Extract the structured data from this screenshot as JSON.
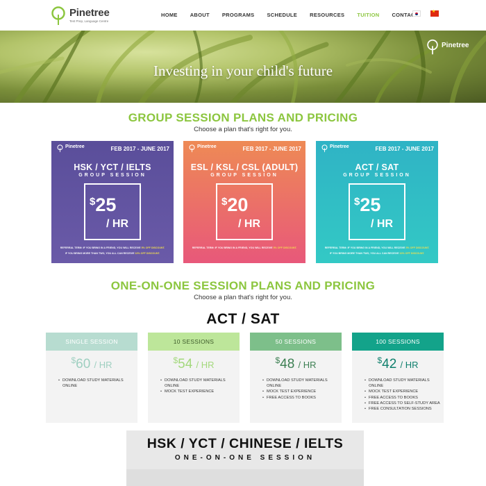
{
  "brand": {
    "name": "Pinetree",
    "tagline": "Test Prep, Language Centre",
    "accent_color": "#8cc63f"
  },
  "nav": {
    "items": [
      {
        "label": "HOME"
      },
      {
        "label": "ABOUT"
      },
      {
        "label": "PROGRAMS"
      },
      {
        "label": "SCHEDULE"
      },
      {
        "label": "RESOURCES"
      },
      {
        "label": "TUITION",
        "active": true
      },
      {
        "label": "CONTACT"
      }
    ],
    "flags": [
      "korea-flag-icon",
      "china-flag-icon"
    ]
  },
  "hero": {
    "title": "Investing in your child's future",
    "logo": "Pinetree"
  },
  "group": {
    "title": "GROUP SESSION PLANS AND PRICING",
    "subtitle": "Choose a plan that's right for you.",
    "cards": [
      {
        "logo": "Pinetree",
        "date": "FEB 2017 - JUNE 2017",
        "name": "HSK / YCT / IELTS",
        "kind": "GROUP SESSION",
        "currency": "$",
        "price": "25",
        "unit": "/ HR",
        "referral_1": "REFERRAL TERM: IF YOU BRING IN A FRIEND, YOU WILL RECEIVE 5% OFF DISCOUNT.",
        "referral_2": "IF YOU BRING MORE THAN TWO, YOU ALL CAN RECEIVE 10% OFF DISCOUNT."
      },
      {
        "logo": "Pinetree",
        "date": "FEB 2017 - JUNE 2017",
        "name": "ESL / KSL / CSL (ADULT)",
        "kind": "GROUP SESSION",
        "currency": "$",
        "price": "20",
        "unit": "/ HR",
        "referral_1": "REFERRAL TERM: IF YOU BRING IN A FRIEND, YOU WILL RECEIVE 5% OFF DISCOUNT."
      },
      {
        "logo": "Pinetree",
        "date": "FEB 2017 - JUNE 2017",
        "name": "ACT / SAT",
        "kind": "GROUP SESSION",
        "currency": "$",
        "price": "25",
        "unit": "/ HR",
        "referral_1": "REFERRAL TERM: IF YOU BRING IN A FRIEND, YOU WILL RECEIVE 5% OFF DISCOUNT.",
        "referral_2": "IF YOU BRING MORE THAN TWO, YOU ALL CAN RECEIVE 10% OFF DISCOUNT."
      }
    ]
  },
  "one_on_one": {
    "title": "ONE-ON-ONE SESSION PLANS AND PRICING",
    "subtitle": "Choose a plan that's right for you.",
    "act_title": "ACT / SAT",
    "plans": [
      {
        "header": "SINGLE SESSION",
        "currency": "$",
        "price": "60",
        "unit": "/ HR",
        "features": [
          "DOWNLOAD STUDY MATERIALS ONLINE"
        ]
      },
      {
        "header": "10 SESSIONS",
        "currency": "$",
        "price": "54",
        "unit": "/ HR",
        "features": [
          "DOWNLOAD STUDY MATERIALS ONLINE",
          "MOCK TEST EXPERIENCE"
        ]
      },
      {
        "header": "50 SESSIONS",
        "currency": "$",
        "price": "48",
        "unit": "/ HR",
        "features": [
          "DOWNLOAD STUDY MATERIALS ONLINE",
          "MOCK TEST EXPERIENCE",
          "FREE ACCESS TO BOOKS"
        ]
      },
      {
        "header": "100 SESSIONS",
        "currency": "$",
        "price": "42",
        "unit": "/ HR",
        "features": [
          "DOWNLOAD STUDY MATERIALS ONLINE",
          "MOCK TEST EXPERIENCE",
          "FREE ACCESS TO BOOKS",
          "FREE ACCESS TO SELF-STUDY AREA",
          "FREE CONSULTATION SESSIONS"
        ]
      }
    ],
    "hsk_title": "HSK / YCT / CHINESE / IELTS",
    "hsk_kind": "ONE-ON-ONE SESSION"
  }
}
